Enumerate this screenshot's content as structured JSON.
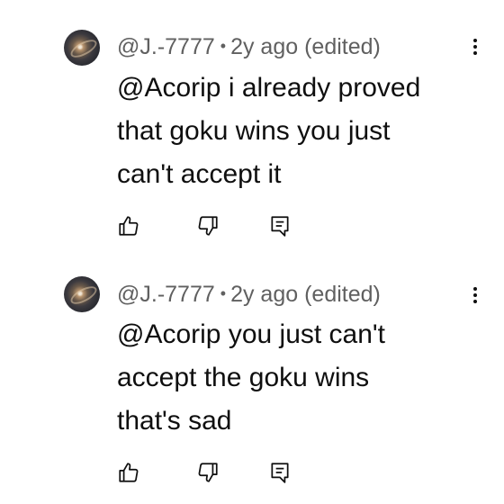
{
  "comments": [
    {
      "author": "@J.-7777",
      "separator": "•",
      "time": "2y ago (edited)",
      "text": "@Acorip i already proved\nthat  goku wins you just\ncan't accept it",
      "icons": {
        "avatar": "galaxy-avatar",
        "like": "thumbs-up-icon",
        "dislike": "thumbs-down-icon",
        "reply": "reply-icon",
        "menu": "more-vert-icon"
      }
    },
    {
      "author": "@J.-7777",
      "separator": "•",
      "time": "2y ago (edited)",
      "text": "@Acorip you just can't\naccept the goku wins\nthat's sad",
      "icons": {
        "avatar": "galaxy-avatar",
        "like": "thumbs-up-icon",
        "dislike": "thumbs-down-icon",
        "reply": "reply-icon",
        "menu": "more-vert-icon"
      }
    }
  ]
}
